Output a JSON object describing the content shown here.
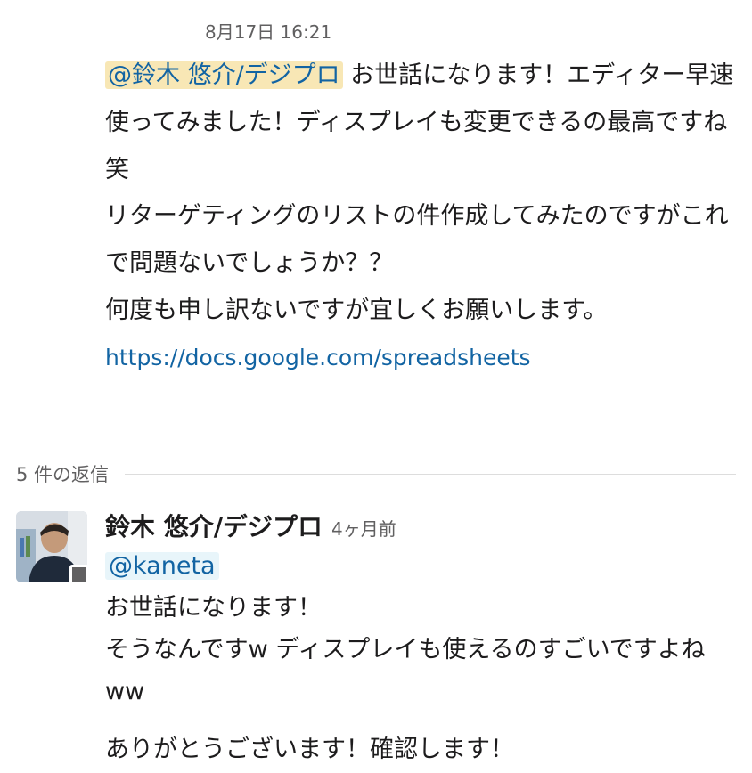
{
  "message": {
    "timestamp": "8月17日 16:21",
    "mention": "@鈴木 悠介/デジプロ",
    "line1_rest": " お世話になります！エディター早速使ってみました！ディスプレイも変更できるの最高ですね笑",
    "para2_line1": "リターゲティングのリストの件作成してみたのですがこれで問題ないでしょうか？？",
    "para2_line2": "何度も申し訳ないですが宜しくお願いします。",
    "link": "https://docs.google.com/spreadsheets"
  },
  "thread": {
    "replies_label": "5 件の返信",
    "reply": {
      "author": "鈴木 悠介/デジプロ",
      "time": "4ヶ月前",
      "mention": "@kaneta",
      "line1": "お世話になります！",
      "line2": "そうなんですw ディスプレイも使えるのすごいですよねww",
      "line3": "ありがとうございます！確認します！"
    }
  }
}
